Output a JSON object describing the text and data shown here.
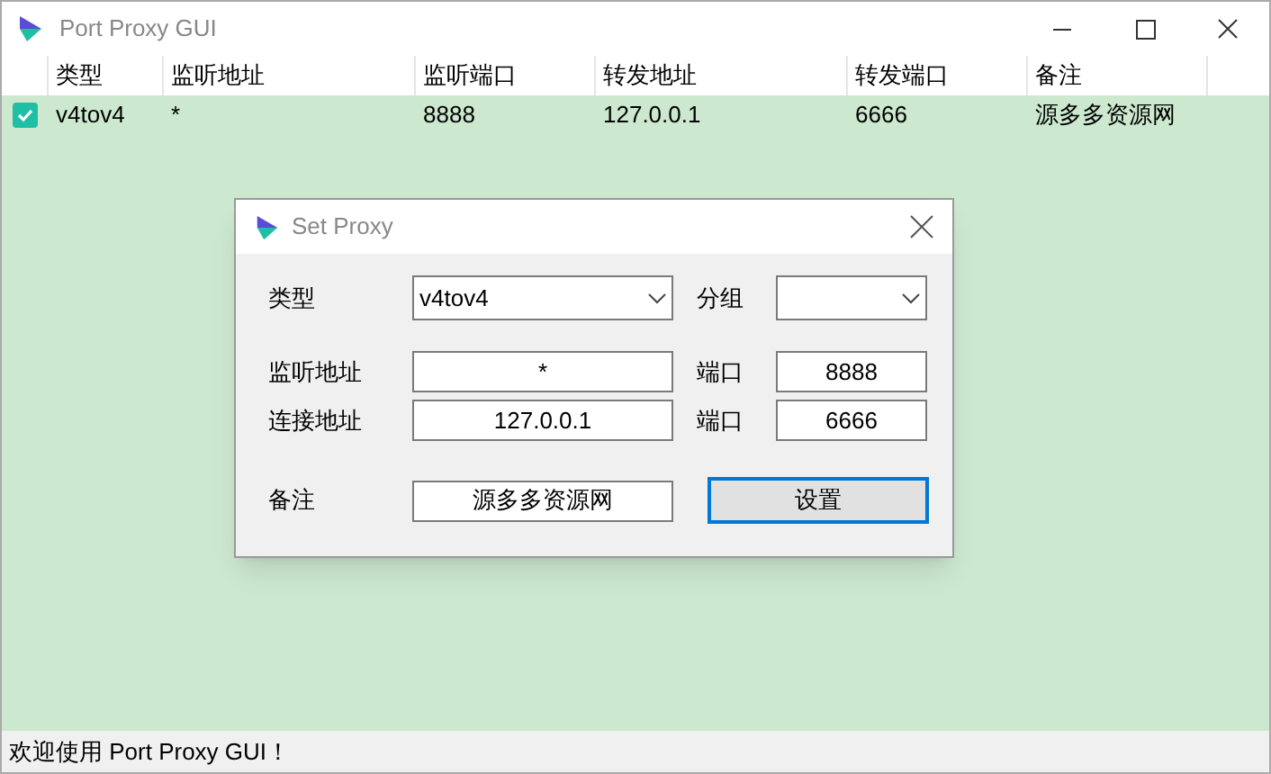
{
  "window": {
    "title": "Port Proxy GUI"
  },
  "table": {
    "columns": [
      "类型",
      "监听地址",
      "监听端口",
      "转发地址",
      "转发端口",
      "备注"
    ],
    "rows": [
      {
        "checked": true,
        "cells": [
          "v4tov4",
          "*",
          "8888",
          "127.0.0.1",
          "6666",
          "源多多资源网"
        ]
      }
    ]
  },
  "dialog": {
    "title": "Set Proxy",
    "type": {
      "label": "类型",
      "value": "v4tov4"
    },
    "group": {
      "label": "分组"
    },
    "listen": {
      "label": "监听地址",
      "value": "*",
      "port_label": "端口",
      "port": "8888"
    },
    "connect": {
      "label": "连接地址",
      "value": "127.0.0.1",
      "port_label": "端口",
      "port": "6666"
    },
    "note": {
      "label": "备注",
      "value": "源多多资源网"
    },
    "button": {
      "label": "设置",
      "focused": true
    }
  },
  "status_bar": "欢迎使用 Port Proxy GUI！"
}
